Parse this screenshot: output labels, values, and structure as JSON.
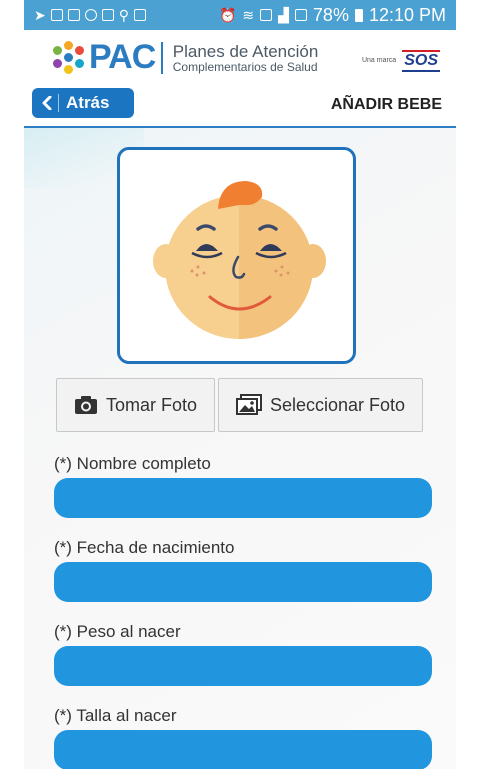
{
  "status_bar": {
    "battery_percent": "78%",
    "time": "12:10 PM"
  },
  "header": {
    "logo_text": "PAC",
    "tagline_line1": "Planes de Atención",
    "tagline_line2": "Complementarios de Salud",
    "brand_prefix": "Una marca",
    "brand_name": "SOS"
  },
  "nav": {
    "back_label": "Atrás",
    "title": "AÑADIR BEBE"
  },
  "photo": {
    "take_label": "Tomar Foto",
    "select_label": "Seleccionar Foto"
  },
  "form": {
    "fields": [
      {
        "label": "(*) Nombre completo",
        "value": ""
      },
      {
        "label": "(*) Fecha de nacimiento",
        "value": ""
      },
      {
        "label": "(*) Peso al nacer",
        "value": ""
      },
      {
        "label": "(*) Talla al nacer",
        "value": ""
      }
    ]
  },
  "colors": {
    "status_bar": "#4ba1d2",
    "brand_blue": "#1b75c0",
    "input_fill": "#2196df",
    "face_skin": "#f7cf8e",
    "hair": "#f07f32"
  }
}
